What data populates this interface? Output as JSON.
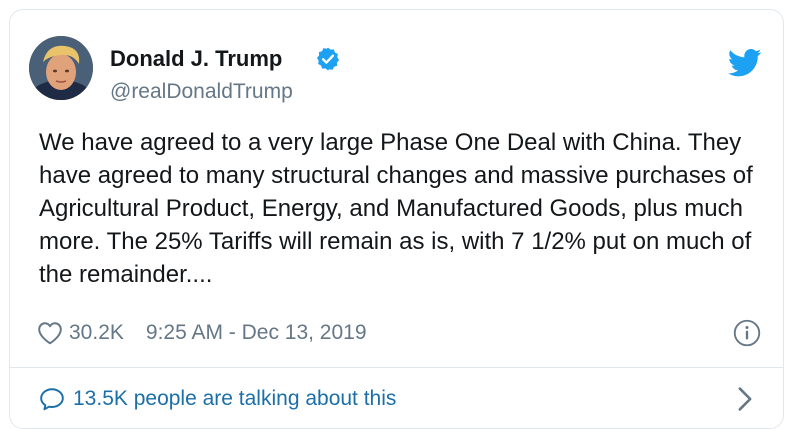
{
  "author": {
    "name": "Donald J. Trump",
    "handle": "@realDonaldTrump",
    "avatar_icon": "profile-photo"
  },
  "tweet": {
    "text": "We have agreed to a very large Phase One Deal with China. They have agreed to many structural changes and massive purchases of Agricultural Product, Energy, and Manufactured Goods, plus much more. The 25% Tariffs will remain as is, with 7 1/2% put on much of the remainder...."
  },
  "meta": {
    "likes": "30.2K",
    "timestamp": "9:25 AM - Dec 13, 2019"
  },
  "footer": {
    "talking": "13.5K people are talking about this"
  },
  "icons": {
    "verified": "verified-badge-icon",
    "platform": "twitter-bird-icon",
    "like": "heart-icon",
    "info": "info-icon",
    "comment": "comment-bubble-icon",
    "more": "chevron-right-icon"
  },
  "colors": {
    "brand": "#1da1f2",
    "link": "#1b6fa8",
    "secondary_text": "#657786",
    "border": "#e1e8ed"
  }
}
